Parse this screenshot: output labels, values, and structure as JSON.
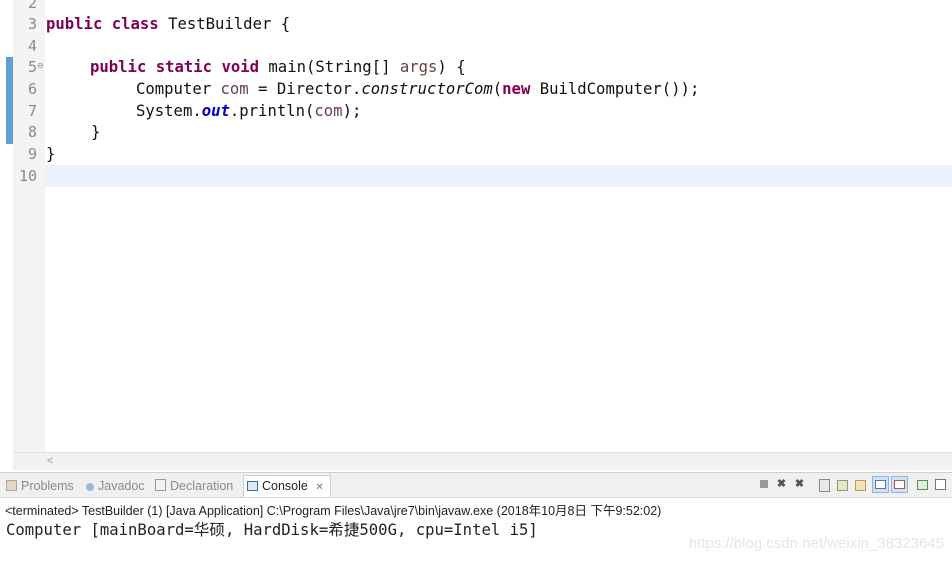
{
  "editor": {
    "line_numbers": [
      "2",
      "3",
      "4",
      "5",
      "6",
      "7",
      "8",
      "9",
      "10"
    ],
    "line5_fold_marker": "⊖",
    "code": {
      "l3": {
        "kw1": "public",
        "kw2": "class",
        "rest": " TestBuilder {"
      },
      "l5": {
        "kw1": "public",
        "kw2": "static",
        "kw3": "void",
        "pre": " main(String[] ",
        "var": "args",
        "post": ") {"
      },
      "l6": {
        "pre": "Computer ",
        "var": "com",
        "mid": " = Director.",
        "method": "constructorCom",
        "open": "(",
        "kw": "new",
        "post": " BuildComputer());"
      },
      "l7": {
        "pre": "System.",
        "field": "out",
        "mid": ".println(",
        "var": "com",
        "post": ");"
      },
      "l8": "}",
      "l9": "}"
    },
    "scroll_arrow": "<"
  },
  "panel": {
    "tabs": {
      "problems": "Problems",
      "javadoc": "Javadoc",
      "declaration": "Declaration",
      "console": "Console",
      "console_close": "✕"
    },
    "status_line": "<terminated> TestBuilder (1) [Java Application] C:\\Program Files\\Java\\jre7\\bin\\javaw.exe (2018年10月8日 下午9:52:02)",
    "output": "Computer [mainBoard=华硕, HardDisk=希捷500G, cpu=Intel i5]",
    "toolbar_icons": [
      "stop-icon",
      "remove-launch-icon",
      "remove-all-icon",
      "scroll-lock-icon",
      "pin-console-icon",
      "word-wrap-icon",
      "show-on-stdout-icon",
      "show-on-stderr-icon",
      "open-console-icon",
      "minimize-icon",
      "maximize-icon"
    ]
  },
  "watermark": "https://blog.csdn.net/weixin_38323645",
  "colors": {
    "keyword": "#7f0055",
    "variable": "#6a3e3e",
    "field": "#0000c0",
    "change_bar": "#5e9fd6",
    "current_line": "#e9f2fb"
  }
}
